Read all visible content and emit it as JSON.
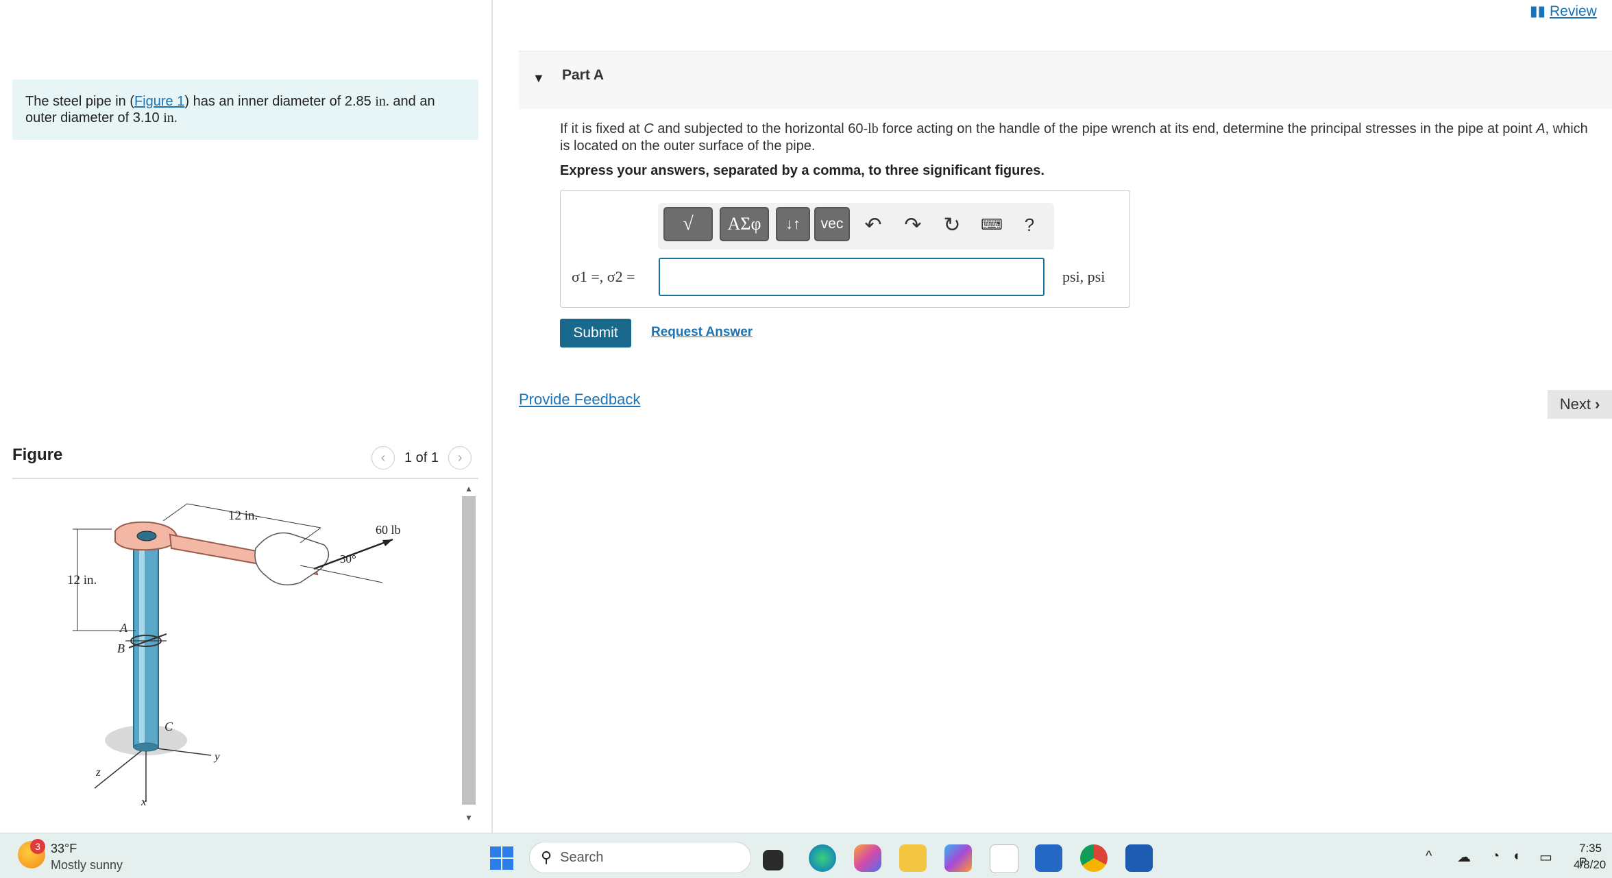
{
  "problem": {
    "prefix": "The steel pipe in (",
    "figure_link": "Figure 1",
    "mid": ") has an inner diameter of 2.85 ",
    "unit1": "in.",
    "mid2": " and an outer diameter of 3.10 ",
    "unit2": "in.",
    "end": ""
  },
  "figure": {
    "title": "Figure",
    "pager": "1 of 1",
    "labels": {
      "top_len": "12 in.",
      "force": "60 lb",
      "angle": "30°",
      "side_len": "12 in.",
      "pt_a": "A",
      "pt_b": "B",
      "pt_c": "C",
      "ax_z": "z",
      "ax_y": "y",
      "ax_x": "x"
    }
  },
  "header": {
    "review": "Review"
  },
  "part": {
    "title": "Part A",
    "question_1": "If it is fixed at ",
    "q_c": "C",
    "question_2": " and subjected to the horizontal 60-",
    "q_lb": "lb",
    "question_3": " force acting on the handle of the pipe wrench at its end, determine the principal stresses in the pipe at point ",
    "q_a": "A",
    "question_4": ", which is located on the outer surface of the pipe.",
    "instruction": "Express your answers, separated by a comma, to three significant figures.",
    "toolbar": {
      "templates": "√",
      "greek": "ΑΣφ",
      "arrows": "↓↑",
      "vec": "vec",
      "help": "?"
    },
    "variable_label": "σ1 =, σ2 =",
    "input_value": "",
    "units": "psi, psi",
    "submit": "Submit",
    "request": "Request Answer"
  },
  "feedback": "Provide Feedback",
  "next": "Next",
  "taskbar": {
    "weather_badge": "3",
    "temp": "33°F",
    "condition": "Mostly sunny",
    "search": "Search",
    "time": "7:35 P",
    "date": "4/8/20"
  }
}
